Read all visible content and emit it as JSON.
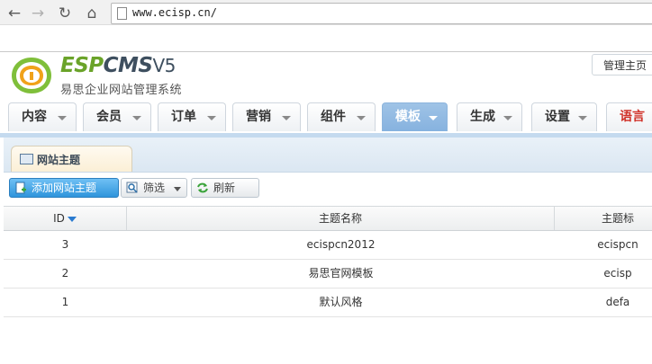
{
  "browser": {
    "url": "www.ecisp.cn/",
    "back_icon": "back-arrow-icon",
    "forward_icon": "forward-arrow-icon",
    "reload_icon": "reload-icon",
    "home_icon": "home-icon"
  },
  "header": {
    "brand_esp": "ESP",
    "brand_cms": "CMS",
    "brand_version": "V5",
    "subtitle": "易思企业网站管理系统",
    "admin_home": "管理主页"
  },
  "menu": {
    "items": [
      {
        "label": "内容"
      },
      {
        "label": "会员"
      },
      {
        "label": "订单"
      },
      {
        "label": "营销"
      },
      {
        "label": "组件"
      },
      {
        "label": "模板",
        "active": true
      },
      {
        "label": "生成"
      },
      {
        "label": "设置"
      },
      {
        "label": "语言"
      }
    ],
    "colors": {
      "active_bg": "#8ab5e0",
      "lang_text": "#d0332a"
    }
  },
  "content": {
    "tab_label": "网站主题",
    "toolbar": {
      "add_label": "添加网站主题",
      "filter_label": "筛选",
      "refresh_label": "刷新"
    },
    "table": {
      "columns": [
        "ID",
        "主题名称",
        "主题标"
      ],
      "rows": [
        {
          "id": "3",
          "name": "ecispcn2012",
          "dir": "ecispcn"
        },
        {
          "id": "2",
          "name": "易思官网模板",
          "dir": "ecisp"
        },
        {
          "id": "1",
          "name": "默认风格",
          "dir": "defa"
        }
      ]
    }
  }
}
